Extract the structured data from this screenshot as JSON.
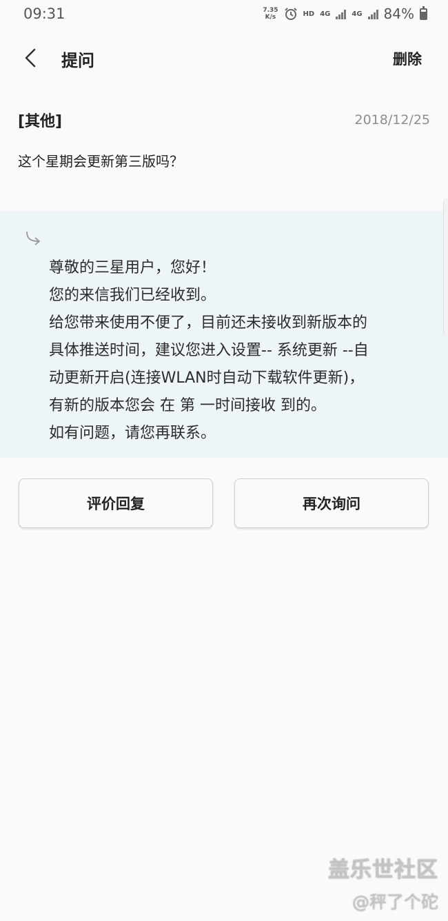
{
  "status_bar": {
    "time": "09:31",
    "net_speed_value": "7.35",
    "net_speed_unit": "K/s",
    "hd_label": "HD",
    "network_1": "4G",
    "network_2": "4G",
    "battery_percent": "84%",
    "icons": [
      "alarm-icon",
      "signal-icon",
      "battery-icon"
    ]
  },
  "app_bar": {
    "title": "提问",
    "delete_label": "删除",
    "back_icon": "chevron-left-icon"
  },
  "question": {
    "category": "[其他]",
    "date": "2018/12/25",
    "text": "这个星期会更新第三版吗？"
  },
  "reply": {
    "arrow_icon": "reply-arrow-icon",
    "lines": [
      "尊敬的三星用户，您好！",
      "您的来信我们已经收到。",
      "给您带来使用不便了，目前还未接收到新版本的",
      "具体推送时间，建议您进入设置-- 系统更新 --自",
      "动更新开启(连接WLAN时自动下载软件更新)，",
      "有新的版本您会 在 第 一时间接收 到的。",
      "如有问题，请您再联系。"
    ]
  },
  "actions": {
    "rate_label": "评价回复",
    "ask_again_label": "再次询问"
  },
  "watermark": {
    "title": "盖乐世社区",
    "user": "@秤了个砣"
  }
}
